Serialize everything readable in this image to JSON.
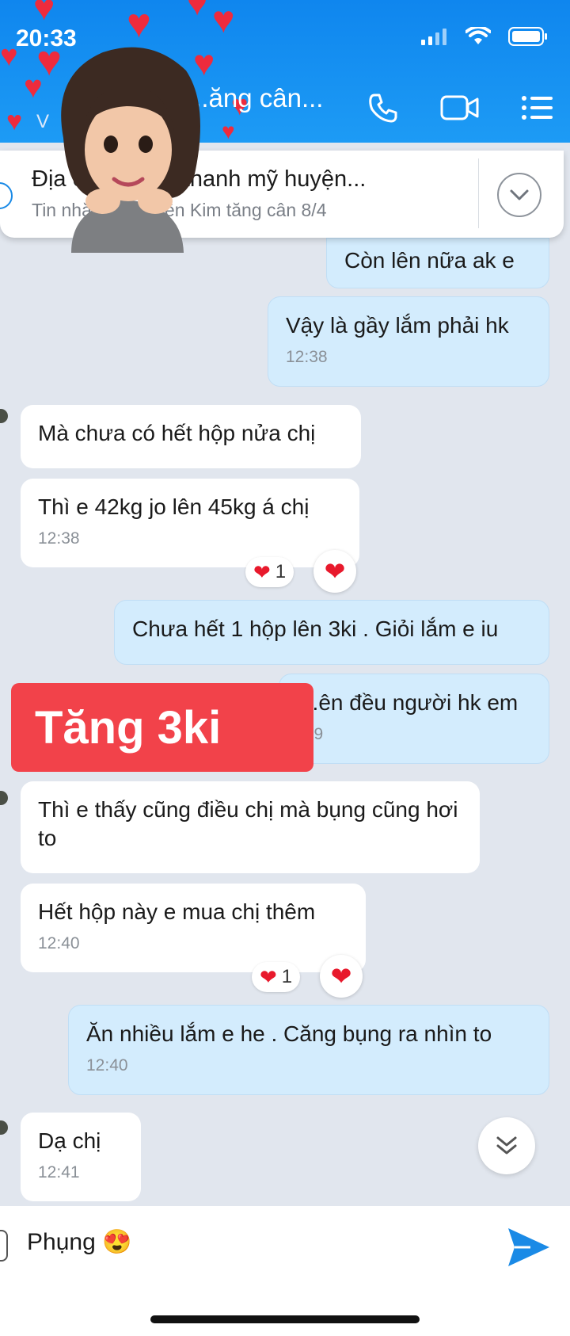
{
  "status_bar": {
    "time": "20:33"
  },
  "header": {
    "title": "...ăng cân...",
    "subtitle": "V"
  },
  "pinned": {
    "line1": "Địa chỉ: ...n xã thanh mỹ huyện...",
    "line2": "Tin nhắn... Nguyễn Kim tăng cân 8/4"
  },
  "messages": [
    {
      "side": "out",
      "text": "Còn lên nữa ak e"
    },
    {
      "side": "out",
      "text": "Vậy là gầy lắm phải hk",
      "time": "12:38"
    },
    {
      "side": "in",
      "text": "Mà chưa có hết hộp nửa chị"
    },
    {
      "side": "in",
      "text": "Thì e 42kg jo lên 45kg á chị",
      "time": "12:38",
      "reaction_count": "1"
    },
    {
      "side": "out",
      "text": "Chưa hết 1 hộp lên 3ki . Giỏi lắm e iu"
    },
    {
      "side": "out",
      "text": "...ên đều người hk em",
      "time": ":39"
    },
    {
      "side": "in",
      "text": "Thì e thấy cũng điều chị mà bụng cũng hơi to"
    },
    {
      "side": "in",
      "text": "Hết hộp này e mua chị thêm",
      "time": "12:40",
      "reaction_count": "1"
    },
    {
      "side": "out",
      "text": "Ăn nhiều lắm e he . Căng bụng ra nhìn to",
      "time": "12:40"
    },
    {
      "side": "in",
      "text": "Dạ chị",
      "time": "12:41"
    }
  ],
  "overlay_banner": "Tăng 3ki",
  "composer": {
    "value": "Phụng 😍"
  },
  "colors": {
    "header": "#1d9bf5",
    "outgoing": "#d3ecfd",
    "incoming": "#ffffff",
    "banner": "#f2424a",
    "reaction": "#e8192c"
  },
  "icons": [
    "signal-icon",
    "wifi-icon",
    "battery-icon",
    "phone-icon",
    "video-call-icon",
    "menu-icon",
    "chevron-down-icon",
    "heart-icon",
    "double-chevron-down-icon",
    "send-icon"
  ]
}
